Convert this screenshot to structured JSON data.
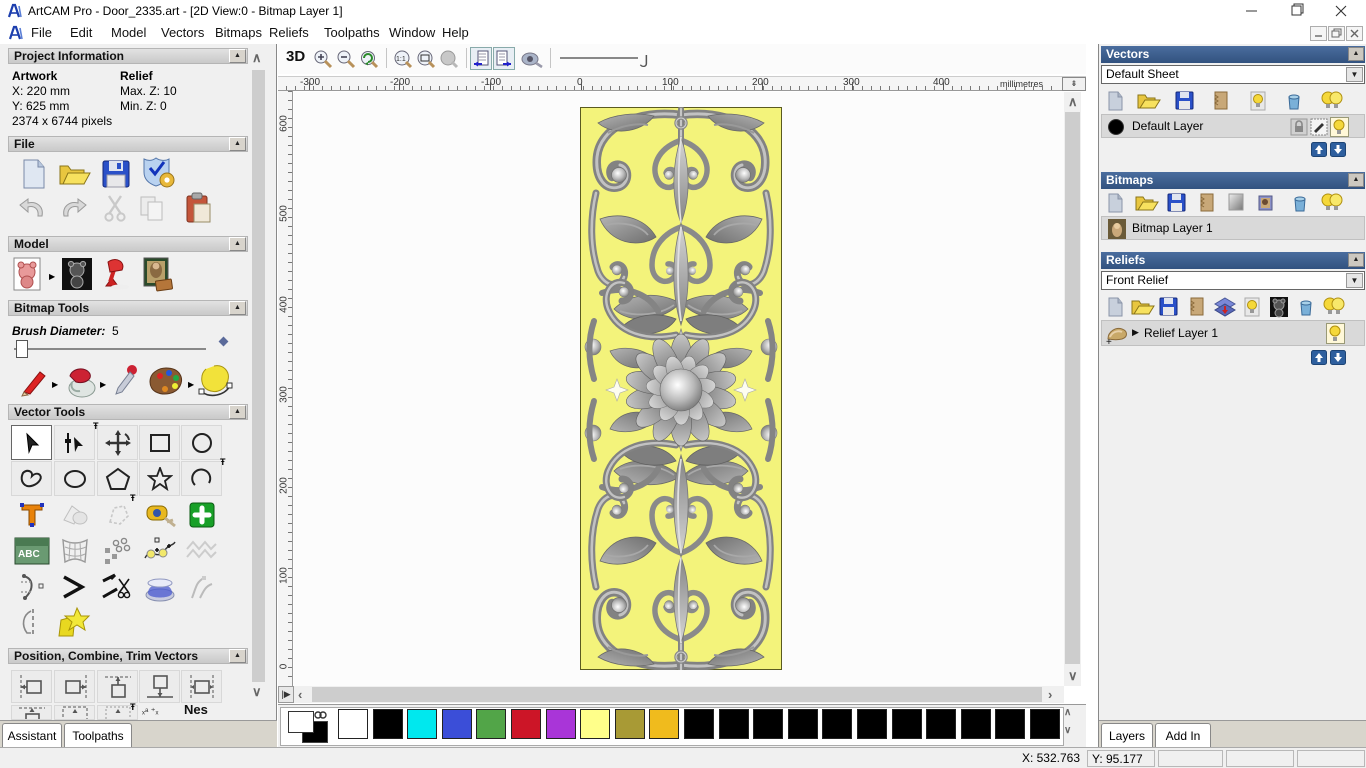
{
  "window": {
    "title": "ArtCAM Pro - Door_2335.art - [2D View:0 - Bitmap Layer 1]"
  },
  "menu": {
    "items": [
      "File",
      "Edit",
      "Model",
      "Vectors",
      "Bitmaps",
      "Reliefs",
      "Toolpaths",
      "Window",
      "Help"
    ]
  },
  "assistant": {
    "project_information": {
      "title": "Project Information",
      "artwork_label": "Artwork",
      "relief_label": "Relief",
      "x": "X: 220 mm",
      "y": "Y: 625 mm",
      "max_z": "Max. Z: 10",
      "min_z": "Min. Z: 0",
      "pixels": "2374 x 6744 pixels"
    },
    "file_section": {
      "title": "File"
    },
    "model_section": {
      "title": "Model"
    },
    "bitmap_tools": {
      "title": "Bitmap Tools",
      "brush_diameter_label": "Brush Diameter:",
      "brush_diameter_value": "5"
    },
    "vector_tools": {
      "title": "Vector Tools"
    },
    "position_section": {
      "title": "Position, Combine, Trim Vectors",
      "nesting_label": "Nes"
    },
    "tabs": {
      "assistant": "Assistant",
      "toolpaths": "Toolpaths"
    }
  },
  "canvas": {
    "toolbar": {
      "view_3d": "3D",
      "zoom_ratio_label": "1:1"
    },
    "ruler": {
      "top_ticks": [
        "-300",
        "-200",
        "-100",
        "0",
        "100",
        "200",
        "300",
        "400"
      ],
      "left_ticks": [
        "600",
        "500",
        "400",
        "300",
        "200",
        "100",
        "0"
      ],
      "units": "millimetres"
    }
  },
  "right_panel": {
    "vectors": {
      "title": "Vectors",
      "sheet_value": "Default Sheet",
      "layer_name": "Default Layer"
    },
    "bitmaps": {
      "title": "Bitmaps",
      "layer_name": "Bitmap Layer 1"
    },
    "reliefs": {
      "title": "Reliefs",
      "relief_value": "Front Relief",
      "layer_name": "Relief Layer 1"
    },
    "tabs": {
      "layers": "Layers",
      "addin": "Add In"
    }
  },
  "status_bar": {
    "x": "X: 532.763",
    "y": "Y: 95.177"
  },
  "palette": {
    "colors": [
      "#ffffff",
      "#000000",
      "#00e8ee",
      "#3b4ed8",
      "#52a548",
      "#cc1527",
      "#a935d8",
      "#ffff8a",
      "#a89a35",
      "#f0bb1d",
      "#000000",
      "#000000",
      "#000000",
      "#000000",
      "#000000",
      "#000000",
      "#000000",
      "#000000",
      "#000000",
      "#000000",
      "#000000"
    ],
    "primary": "#ffffff",
    "secondary": "#000000"
  },
  "icons": {
    "file": [
      "new-model-icon",
      "open-icon",
      "save-icon",
      "model-properties-icon",
      "undo-icon",
      "redo-icon",
      "cut-icon",
      "copy-icon",
      "paste-icon"
    ],
    "model": [
      "set-model-size-icon",
      "invert-model-icon",
      "lighting-icon",
      "load-bitmap-icon"
    ],
    "bitmap_tools": [
      "paint-icon",
      "flood-fill-icon",
      "pick-colour-icon",
      "colour-palette-icon",
      "bitmap-to-vector-icon"
    ],
    "vector_tools": [
      "select-icon",
      "node-edit-icon",
      "transform-icon",
      "rectangle-icon",
      "ellipse-icon",
      "freehand-icon",
      "circle-icon",
      "polygon-icon",
      "star-icon",
      "arc-icon",
      "text-icon",
      "weld-icon",
      "polyline-icon",
      "measure-icon",
      "snap-icon",
      "text-on-curve-icon",
      "envelope-icon",
      "block-copy-icon",
      "paste-along-curve-icon",
      "texture-icon",
      "fillet-icon",
      "offset-icon",
      "trim-icon",
      "spin-icon",
      "extrude-icon",
      "mirror-icon",
      "vector-doctor-icon"
    ],
    "vectors_panel": [
      "new-icon",
      "open-icon",
      "save-icon",
      "merge-icon",
      "toggle-visibility-icon",
      "delete-icon",
      "all-visible-icon",
      "lock-icon",
      "edit-colour-icon",
      "bulb-icon"
    ],
    "bitmaps_panel": [
      "new-icon",
      "open-icon",
      "save-icon",
      "merge-icon",
      "greyscale-icon",
      "convert-icon",
      "delete-icon",
      "all-visible-icon"
    ],
    "reliefs_panel": [
      "new-icon",
      "open-icon",
      "save-icon",
      "merge-icon",
      "stack-icon",
      "toggle-visibility-icon",
      "greyscale-teddy-icon",
      "delete-icon",
      "all-visible-icon"
    ]
  }
}
